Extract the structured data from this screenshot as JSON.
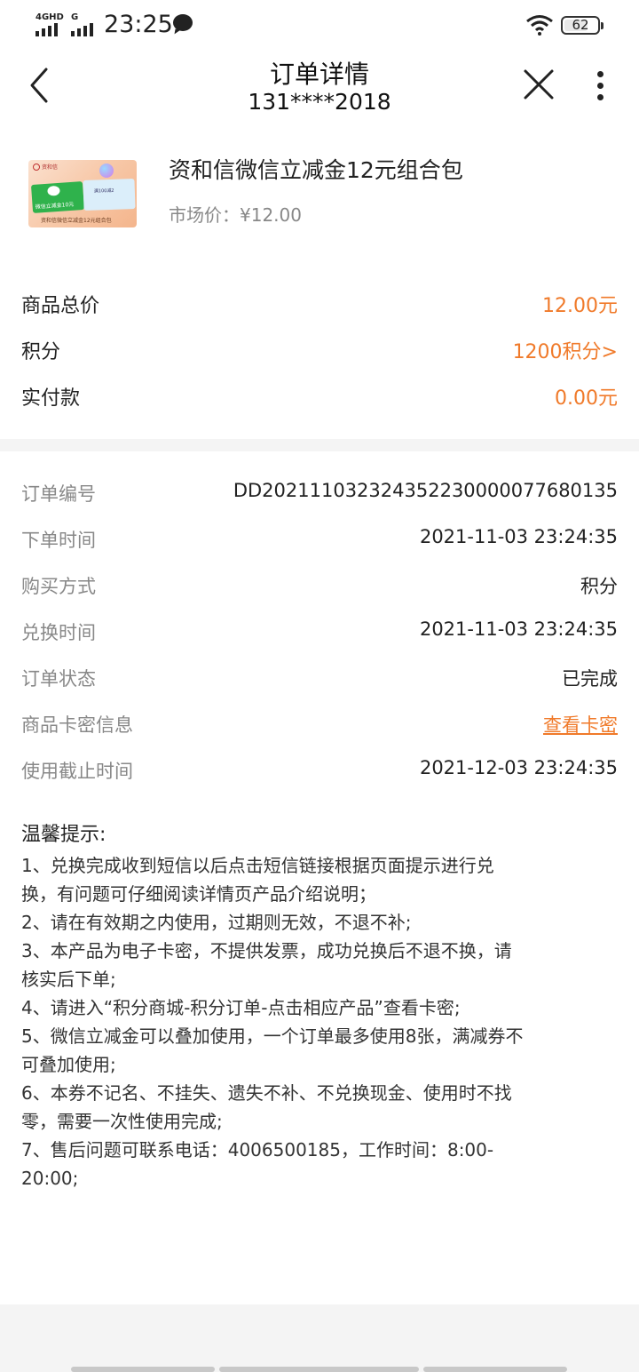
{
  "status_bar": {
    "network1": "4GHD",
    "network2": "G",
    "time": "23:25",
    "battery": "62"
  },
  "nav": {
    "title": "订单详情",
    "subtitle": "131****2018"
  },
  "product": {
    "name": "资和信微信立减金12元组合包",
    "market_price": "市场价：¥12.00",
    "thumb_logo": "资和信",
    "thumb_green_text": "微信立减金10元",
    "thumb_blue_text": "满100减2",
    "thumb_caption": "资和信微信立减金12元组合包"
  },
  "summary": [
    {
      "label": "商品总价",
      "value": "12.00元"
    },
    {
      "label": "积分",
      "value": "1200积分>"
    },
    {
      "label": "实付款",
      "value": "0.00元"
    }
  ],
  "details": [
    {
      "label": "订单编号",
      "value": "DD2021110323243522300000776801​35"
    },
    {
      "label": "下单时间",
      "value": "2021-11-03 23:24:35"
    },
    {
      "label": "购买方式",
      "value": "积分"
    },
    {
      "label": "兑换时间",
      "value": "2021-11-03 23:24:35"
    },
    {
      "label": "订单状态",
      "value": "已完成"
    },
    {
      "label": "商品卡密信息",
      "value": "查看卡密"
    },
    {
      "label": "使用截止时间",
      "value": "2021-12-03 23:24:35"
    }
  ],
  "tips": {
    "title": "温馨提示:",
    "lines": [
      "1、兑换完成收到短信以后点击短信链接根据页面提示进行兑",
      "换，有问题可仔细阅读详情页产品介绍说明；",
      "2、请在有效期之内使用，过期则无效，不退不补;",
      "3、本产品为电子卡密，不提供发票，成功兑换后不退不换，请",
      "核实后下单;",
      "4、请进入“积分商城-积分订单-点击相应产品”查看卡密;",
      "5、微信立减金可以叠加使用，一个订单最多使用8张，满减券不",
      "可叠加使用;",
      "6、本券不记名、不挂失、遗失不补、不兑换现金、使用时不找",
      "零，需要一次性使用完成;",
      "7、售后问题可联系电话：4006500185，工作时间：8:00-",
      "20:00;"
    ]
  }
}
